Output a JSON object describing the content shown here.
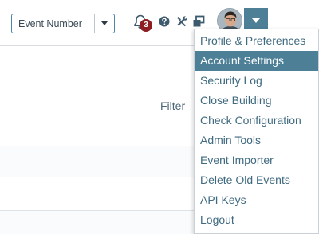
{
  "header": {
    "event_select": {
      "value": "Event Number"
    },
    "notifications": {
      "count": "3"
    },
    "icons": {
      "bell": "bell-icon",
      "help": "question-circle-icon",
      "tools": "wrench-screwdriver-icon",
      "windows": "windows-icon",
      "user_menu": "caret-down-icon"
    }
  },
  "main": {
    "filter_label": "Filter"
  },
  "user_menu": {
    "items": [
      {
        "label": "Profile & Preferences"
      },
      {
        "label": "Account Settings",
        "active": true
      },
      {
        "label": "Security Log"
      },
      {
        "label": "Close Building"
      },
      {
        "label": "Check Configuration"
      },
      {
        "label": "Admin Tools"
      },
      {
        "label": "Event Importer"
      },
      {
        "label": "Delete Old Events"
      },
      {
        "label": "API Keys"
      },
      {
        "label": "Logout"
      }
    ]
  },
  "colors": {
    "accent": "#4d7f97",
    "badge": "#8d1f24",
    "link_text": "#3f6a80"
  }
}
